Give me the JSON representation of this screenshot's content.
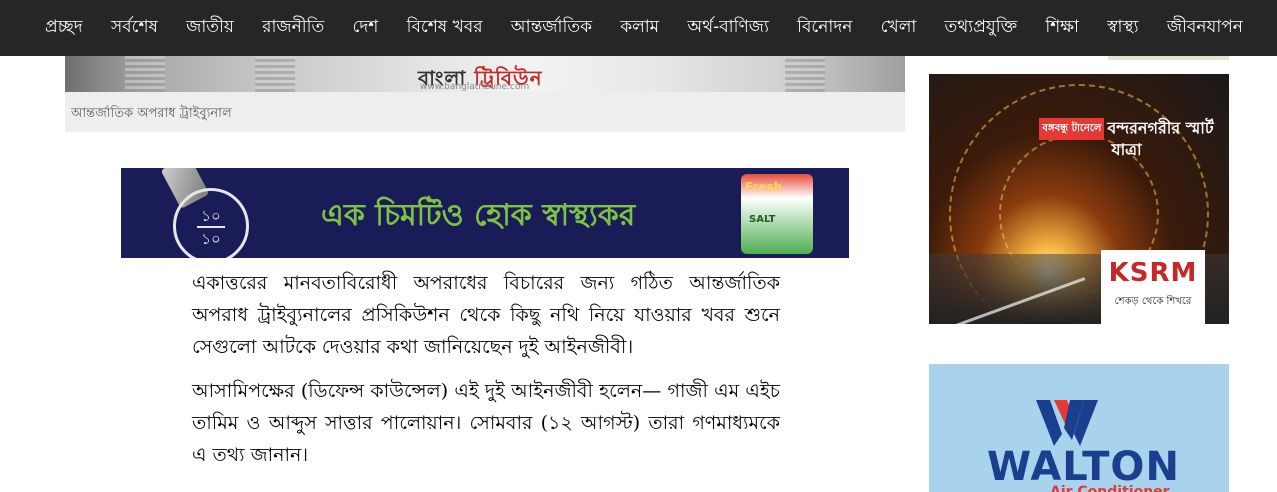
{
  "nav": {
    "items": [
      "প্রচ্ছদ",
      "সর্বশেষ",
      "জাতীয়",
      "রাজনীতি",
      "দেশ",
      "বিশেষ খবর",
      "আন্তর্জাতিক",
      "কলাম",
      "অর্থ-বাণিজ্য",
      "বিনোদন",
      "খেলা",
      "তথ্যপ্রযুক্তি",
      "শিক্ষা",
      "স্বাস্থ্য",
      "জীবনযাপন"
    ]
  },
  "hero": {
    "logo_prefix": "বাংলা",
    "logo_suffix": "ট্রিবিউন",
    "url": "www.banglatribune.com"
  },
  "caption": "আন্তর্জাতিক অপরাধ ট্রাইব্যুনাল",
  "banner": {
    "badge_top": "১০",
    "badge_bottom": "১০",
    "slogan": "এক চিমটিও হোক স্বাস্থ্যকর",
    "product_brand": "Fresh",
    "product_name": "SALT"
  },
  "article": {
    "paragraphs": [
      "একাত্তরের মানবতাবিরোধী অপরাধের বিচারের জন্য গঠিত আন্তর্জাতিক অপরাধ ট্রাইব্যুনালের প্রসিকিউশন থেকে কিছু নথি নিয়ে যাওয়ার খবর শুনে সেগুলো আটকে দেওয়ার কথা জানিয়েছেন দুই আইনজীবী।",
      "আসামিপক্ষের (ডিফেন্স কাউন্সেল) এই দুই আইনজীবী হলেন— গাজী এম এইচ তামিম ও আব্দুস সাত্তার পালোয়ান। সোমবার (১২ আগস্ট) তারা গণমাধ্যমকে এ তথ্য জানান।"
    ]
  },
  "ads": {
    "tunnel": {
      "tag": "বঙ্গবন্ধু টানেলে",
      "headline": "বন্দরনগরীর স্মার্ট যাত্রা",
      "brand": "KSRM",
      "tagline": "শেকড় থেকে শিখরে"
    },
    "walton": {
      "brand": "WALTON",
      "sub": "Air Conditioner"
    }
  },
  "colors": {
    "nav_bg": "#262626",
    "banner_bg": "#191c56",
    "banner_slogan": "#7dc242",
    "walton_blue": "#1a3f8f",
    "walton_bg": "#a9d2ec"
  }
}
